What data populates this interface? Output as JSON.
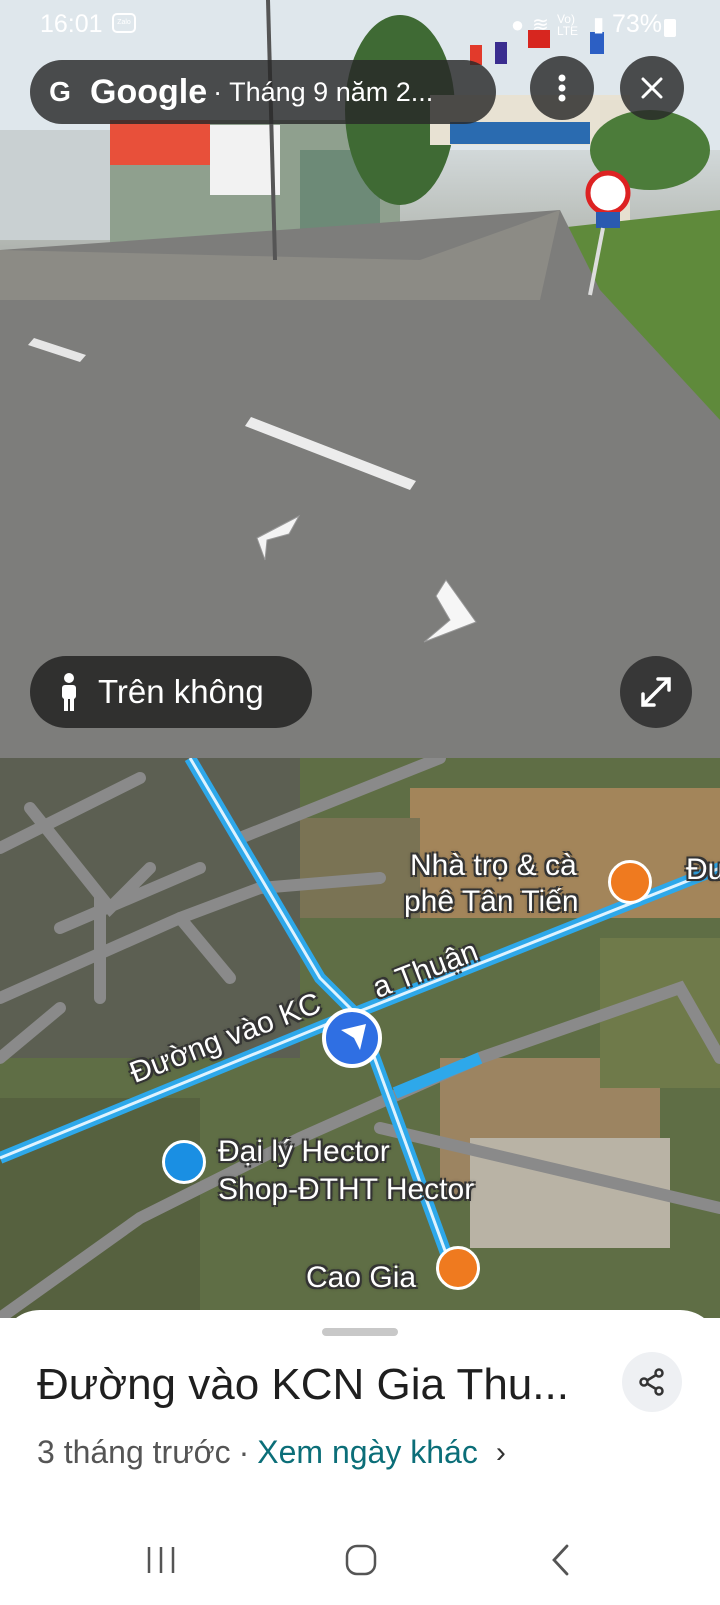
{
  "status_bar": {
    "time": "16:01",
    "notification_app": "Zalo",
    "signal": "Vo) LTE",
    "battery": "73%"
  },
  "street_view": {
    "brand_letter": "G",
    "brand": "Google",
    "date": "· Tháng 9 năm 2...",
    "aerial_button_label": "Trên không",
    "icons": [
      "more-vert-icon",
      "close-icon",
      "pegman-icon",
      "expand-icon",
      "nav-arrow-left",
      "nav-arrow-right"
    ]
  },
  "map": {
    "labels": {
      "nha_tro_line1": "Nhà trọ & cà",
      "nha_tro_line2": "phê Tân Tiến",
      "road_label_left": "Đường vào KC",
      "road_label_right": "a Thuận",
      "road_edge": "Đư",
      "hector_line1": "Đại lý Hector",
      "hector_line2": "Shop-ĐTHT Hector",
      "cao_gia": "Cao Gia"
    },
    "colors": {
      "road_highlight": "#2ea8ea",
      "road_gray": "#8a8a8a",
      "cafe_pin": "#ef7a1f",
      "shop_pin": "#1a8fe3",
      "location": "#2f6fe3"
    }
  },
  "sheet": {
    "title": "Đường vào KCN Gia Thu...",
    "time_ago": "3 tháng trước",
    "separator": "·",
    "other_dates": "Xem ngày khác",
    "chevron": "›"
  }
}
